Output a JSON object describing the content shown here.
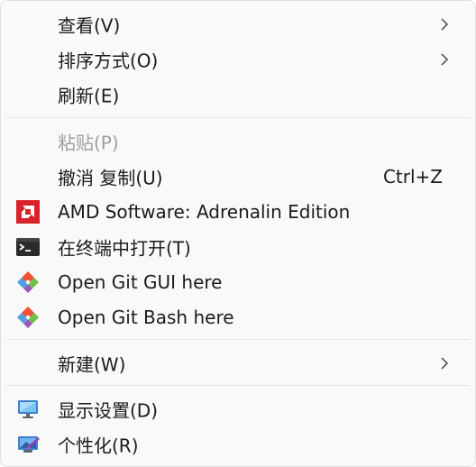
{
  "menu": {
    "view": {
      "label": "查看(V)"
    },
    "sort": {
      "label": "排序方式(O)"
    },
    "refresh": {
      "label": "刷新(E)"
    },
    "paste": {
      "label": "粘贴(P)"
    },
    "undo": {
      "label": "撤消 复制(U)",
      "shortcut": "Ctrl+Z"
    },
    "amd": {
      "label": "AMD Software: Adrenalin Edition",
      "icon": "amd-logo-icon"
    },
    "terminal": {
      "label": "在终端中打开(T)",
      "icon": "terminal-icon"
    },
    "git_gui": {
      "label": "Open Git GUI here",
      "icon": "git-icon"
    },
    "git_bash": {
      "label": "Open Git Bash here",
      "icon": "git-icon"
    },
    "new": {
      "label": "新建(W)"
    },
    "display": {
      "label": "显示设置(D)",
      "icon": "monitor-icon"
    },
    "personalize": {
      "label": "个性化(R)",
      "icon": "personalize-icon"
    }
  },
  "colors": {
    "menu_bg": "#f9f9f9",
    "text": "#1b1b1b",
    "disabled_text": "#9e9e9e",
    "separator": "#e3e3e3",
    "amd_red": "#d8232a"
  }
}
